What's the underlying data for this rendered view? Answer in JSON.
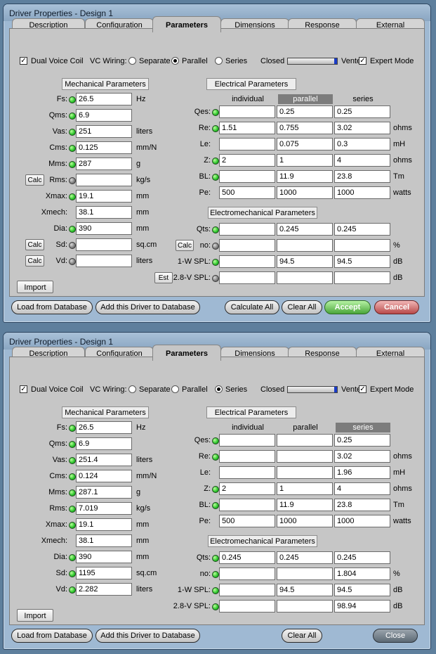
{
  "windows": [
    {
      "title": "Driver Properties - Design 1",
      "tabs": [
        "Description",
        "Configuration",
        "Parameters",
        "Dimensions",
        "Response",
        "External"
      ],
      "active_tab": "Parameters",
      "options": {
        "dual_voice_coil": "Dual Voice Coil",
        "vc_wiring": "VC Wiring:",
        "separate": "Separate",
        "parallel": "Parallel",
        "series": "Series",
        "closed": "Closed",
        "vented": "Vented",
        "expert_mode": "Expert Mode",
        "wiring_selected": "parallel",
        "slider_value": 1.0
      },
      "mech_title": "Mechanical Parameters",
      "mech": [
        {
          "label": "Fs:",
          "value": "26.5",
          "unit": "Hz",
          "led": "green",
          "calc": ""
        },
        {
          "label": "Qms:",
          "value": "6.9",
          "unit": "",
          "led": "green",
          "calc": ""
        },
        {
          "label": "Vas:",
          "value": "251",
          "unit": "liters",
          "led": "green",
          "calc": ""
        },
        {
          "label": "Cms:",
          "value": "0.125",
          "unit": "mm/N",
          "led": "green",
          "calc": ""
        },
        {
          "label": "Mms:",
          "value": "287",
          "unit": "g",
          "led": "green",
          "calc": ""
        },
        {
          "label": "Rms:",
          "value": "",
          "unit": "kg/s",
          "led": "gray",
          "calc": "Calc"
        },
        {
          "label": "Xmax:",
          "value": "19.1",
          "unit": "mm",
          "led": "green",
          "calc": ""
        },
        {
          "label": "Xmech:",
          "value": "38.1",
          "unit": "mm",
          "led": "none",
          "calc": ""
        },
        {
          "label": "Dia:",
          "value": "390",
          "unit": "mm",
          "led": "green",
          "calc": ""
        },
        {
          "label": "Sd:",
          "value": "",
          "unit": "sq.cm",
          "led": "gray",
          "calc": "Calc"
        },
        {
          "label": "Vd:",
          "value": "",
          "unit": "liters",
          "led": "gray",
          "calc": "Calc"
        }
      ],
      "import_label": "Import",
      "elec_title": "Electrical Parameters",
      "col_headers": [
        "individual",
        "parallel",
        "series"
      ],
      "col_selected": 1,
      "elec": [
        {
          "label": "Qes:",
          "led": "green",
          "values": [
            "",
            "0.25",
            "0.25"
          ],
          "unit": ""
        },
        {
          "label": "Re:",
          "led": "green",
          "values": [
            "1.51",
            "0.755",
            "3.02"
          ],
          "unit": "ohms"
        },
        {
          "label": "Le:",
          "led": "none",
          "values": [
            "",
            "0.075",
            "0.3"
          ],
          "unit": "mH"
        },
        {
          "label": "Z:",
          "led": "green",
          "values": [
            "2",
            "1",
            "4"
          ],
          "unit": "ohms"
        },
        {
          "label": "BL:",
          "led": "green",
          "values": [
            "",
            "11.9",
            "23.8"
          ],
          "unit": "Tm"
        },
        {
          "label": "Pe:",
          "led": "none",
          "values": [
            "500",
            "1000",
            "1000"
          ],
          "unit": "watts"
        }
      ],
      "em_title": "Electromechanical Parameters",
      "em": [
        {
          "label": "Qts:",
          "led": "green",
          "values": [
            "",
            "0.245",
            "0.245"
          ],
          "unit": "",
          "btn": ""
        },
        {
          "label": "no:",
          "led": "gray",
          "values": [
            "",
            "",
            ""
          ],
          "unit": "%",
          "btn": "Calc"
        },
        {
          "label": "1-W SPL:",
          "led": "green",
          "values": [
            "",
            "94.5",
            "94.5"
          ],
          "unit": "dB",
          "btn": ""
        },
        {
          "label": "2.8-V SPL:",
          "led": "gray",
          "values": [
            "",
            "",
            ""
          ],
          "unit": "dB",
          "btn": "Est"
        }
      ],
      "buttons": {
        "load": "Load from Database",
        "add": "Add this Driver to Database",
        "calculate": "Calculate All",
        "clear": "Clear All",
        "accept": "Accept",
        "cancel": "Cancel",
        "close": ""
      }
    },
    {
      "title": "Driver Properties - Design 1",
      "tabs": [
        "Description",
        "Configuration",
        "Parameters",
        "Dimensions",
        "Response",
        "External"
      ],
      "active_tab": "Parameters",
      "options": {
        "dual_voice_coil": "Dual Voice Coil",
        "vc_wiring": "VC Wiring:",
        "separate": "Separate",
        "parallel": "Parallel",
        "series": "Series",
        "closed": "Closed",
        "vented": "Vented",
        "expert_mode": "Expert Mode",
        "wiring_selected": "series",
        "slider_value": 1.0
      },
      "mech_title": "Mechanical Parameters",
      "mech": [
        {
          "label": "Fs:",
          "value": "26.5",
          "unit": "Hz",
          "led": "green",
          "calc": ""
        },
        {
          "label": "Qms:",
          "value": "6.9",
          "unit": "",
          "led": "green",
          "calc": ""
        },
        {
          "label": "Vas:",
          "value": "251.4",
          "unit": "liters",
          "led": "green",
          "calc": ""
        },
        {
          "label": "Cms:",
          "value": "0.124",
          "unit": "mm/N",
          "led": "green",
          "calc": ""
        },
        {
          "label": "Mms:",
          "value": "287.1",
          "unit": "g",
          "led": "green",
          "calc": ""
        },
        {
          "label": "Rms:",
          "value": "7.019",
          "unit": "kg/s",
          "led": "green",
          "calc": ""
        },
        {
          "label": "Xmax:",
          "value": "19.1",
          "unit": "mm",
          "led": "green",
          "calc": ""
        },
        {
          "label": "Xmech:",
          "value": "38.1",
          "unit": "mm",
          "led": "none",
          "calc": ""
        },
        {
          "label": "Dia:",
          "value": "390",
          "unit": "mm",
          "led": "green",
          "calc": ""
        },
        {
          "label": "Sd:",
          "value": "1195",
          "unit": "sq.cm",
          "led": "green",
          "calc": ""
        },
        {
          "label": "Vd:",
          "value": "2.282",
          "unit": "liters",
          "led": "green",
          "calc": ""
        }
      ],
      "import_label": "Import",
      "elec_title": "Electrical Parameters",
      "col_headers": [
        "individual",
        "parallel",
        "series"
      ],
      "col_selected": 2,
      "elec": [
        {
          "label": "Qes:",
          "led": "green",
          "values": [
            "",
            "",
            "0.25"
          ],
          "unit": ""
        },
        {
          "label": "Re:",
          "led": "green",
          "values": [
            "",
            "",
            "3.02"
          ],
          "unit": "ohms"
        },
        {
          "label": "Le:",
          "led": "none",
          "values": [
            "",
            "",
            "1.96"
          ],
          "unit": "mH"
        },
        {
          "label": "Z:",
          "led": "green",
          "values": [
            "2",
            "1",
            "4"
          ],
          "unit": "ohms"
        },
        {
          "label": "BL:",
          "led": "green",
          "values": [
            "",
            "11.9",
            "23.8"
          ],
          "unit": "Tm"
        },
        {
          "label": "Pe:",
          "led": "none",
          "values": [
            "500",
            "1000",
            "1000"
          ],
          "unit": "watts"
        }
      ],
      "em_title": "Electromechanical Parameters",
      "em": [
        {
          "label": "Qts:",
          "led": "green",
          "values": [
            "0.245",
            "0.245",
            "0.245"
          ],
          "unit": "",
          "btn": ""
        },
        {
          "label": "no:",
          "led": "green",
          "values": [
            "",
            "",
            "1.804"
          ],
          "unit": "%",
          "btn": ""
        },
        {
          "label": "1-W SPL:",
          "led": "green",
          "values": [
            "",
            "94.5",
            "94.5"
          ],
          "unit": "dB",
          "btn": ""
        },
        {
          "label": "2.8-V SPL:",
          "led": "green",
          "values": [
            "",
            "",
            "98.94"
          ],
          "unit": "dB",
          "btn": ""
        }
      ],
      "buttons": {
        "load": "Load from Database",
        "add": "Add this Driver to Database",
        "calculate": "",
        "clear": "Clear All",
        "accept": "",
        "cancel": "",
        "close": "Close"
      }
    }
  ]
}
